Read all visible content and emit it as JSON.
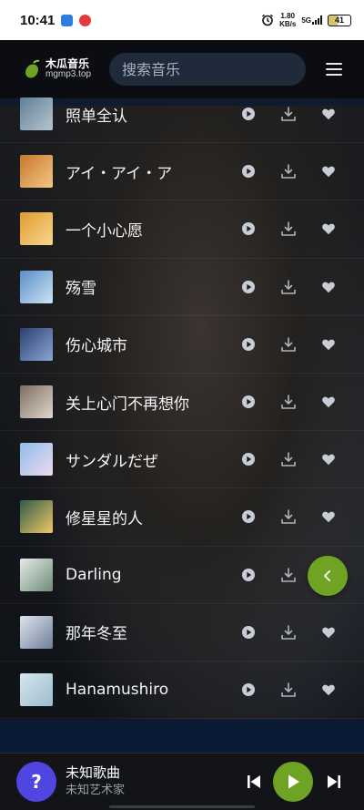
{
  "status_bar": {
    "time": "10:41",
    "speed_value": "1.80",
    "speed_unit": "KB/s",
    "network": "5G",
    "battery": "41"
  },
  "header": {
    "logo_name": "木瓜音乐",
    "logo_url": "mgmp3.top",
    "search_placeholder": "搜索音乐"
  },
  "songs": [
    {
      "title": "照单全认",
      "cover_colors": [
        "#5f7f95",
        "#b7c6cf"
      ]
    },
    {
      "title": "アイ・アイ・ア",
      "cover_colors": [
        "#c7772e",
        "#f2c784"
      ]
    },
    {
      "title": "一个小心愿",
      "cover_colors": [
        "#e09b2f",
        "#f6d790"
      ]
    },
    {
      "title": "殇雪",
      "cover_colors": [
        "#5a8ec8",
        "#cde3f5"
      ]
    },
    {
      "title": "伤心城市",
      "cover_colors": [
        "#2b3f6e",
        "#8aa6d6"
      ]
    },
    {
      "title": "关上心门不再想你",
      "cover_colors": [
        "#7a6d62",
        "#e3d6ca"
      ]
    },
    {
      "title": "サンダルだぜ",
      "cover_colors": [
        "#8dbde8",
        "#f0d9ef"
      ]
    },
    {
      "title": "修星星的人",
      "cover_colors": [
        "#2e5b4a",
        "#f0c765"
      ]
    },
    {
      "title": "Darling",
      "cover_colors": [
        "#e8ebe8",
        "#6c8b78"
      ]
    },
    {
      "title": "那年冬至",
      "cover_colors": [
        "#dde4ee",
        "#6f7f98"
      ]
    },
    {
      "title": "Hanamushiro",
      "cover_colors": [
        "#d7e6ee",
        "#9cbdcc"
      ]
    }
  ],
  "player": {
    "avatar_symbol": "?",
    "track_title": "未知歌曲",
    "track_artist": "未知艺术家"
  },
  "colors": {
    "accent": "#6ea323",
    "avatar": "#5145e0",
    "header_bg": "#0b0d12",
    "search_bg": "#1f2a3a"
  }
}
